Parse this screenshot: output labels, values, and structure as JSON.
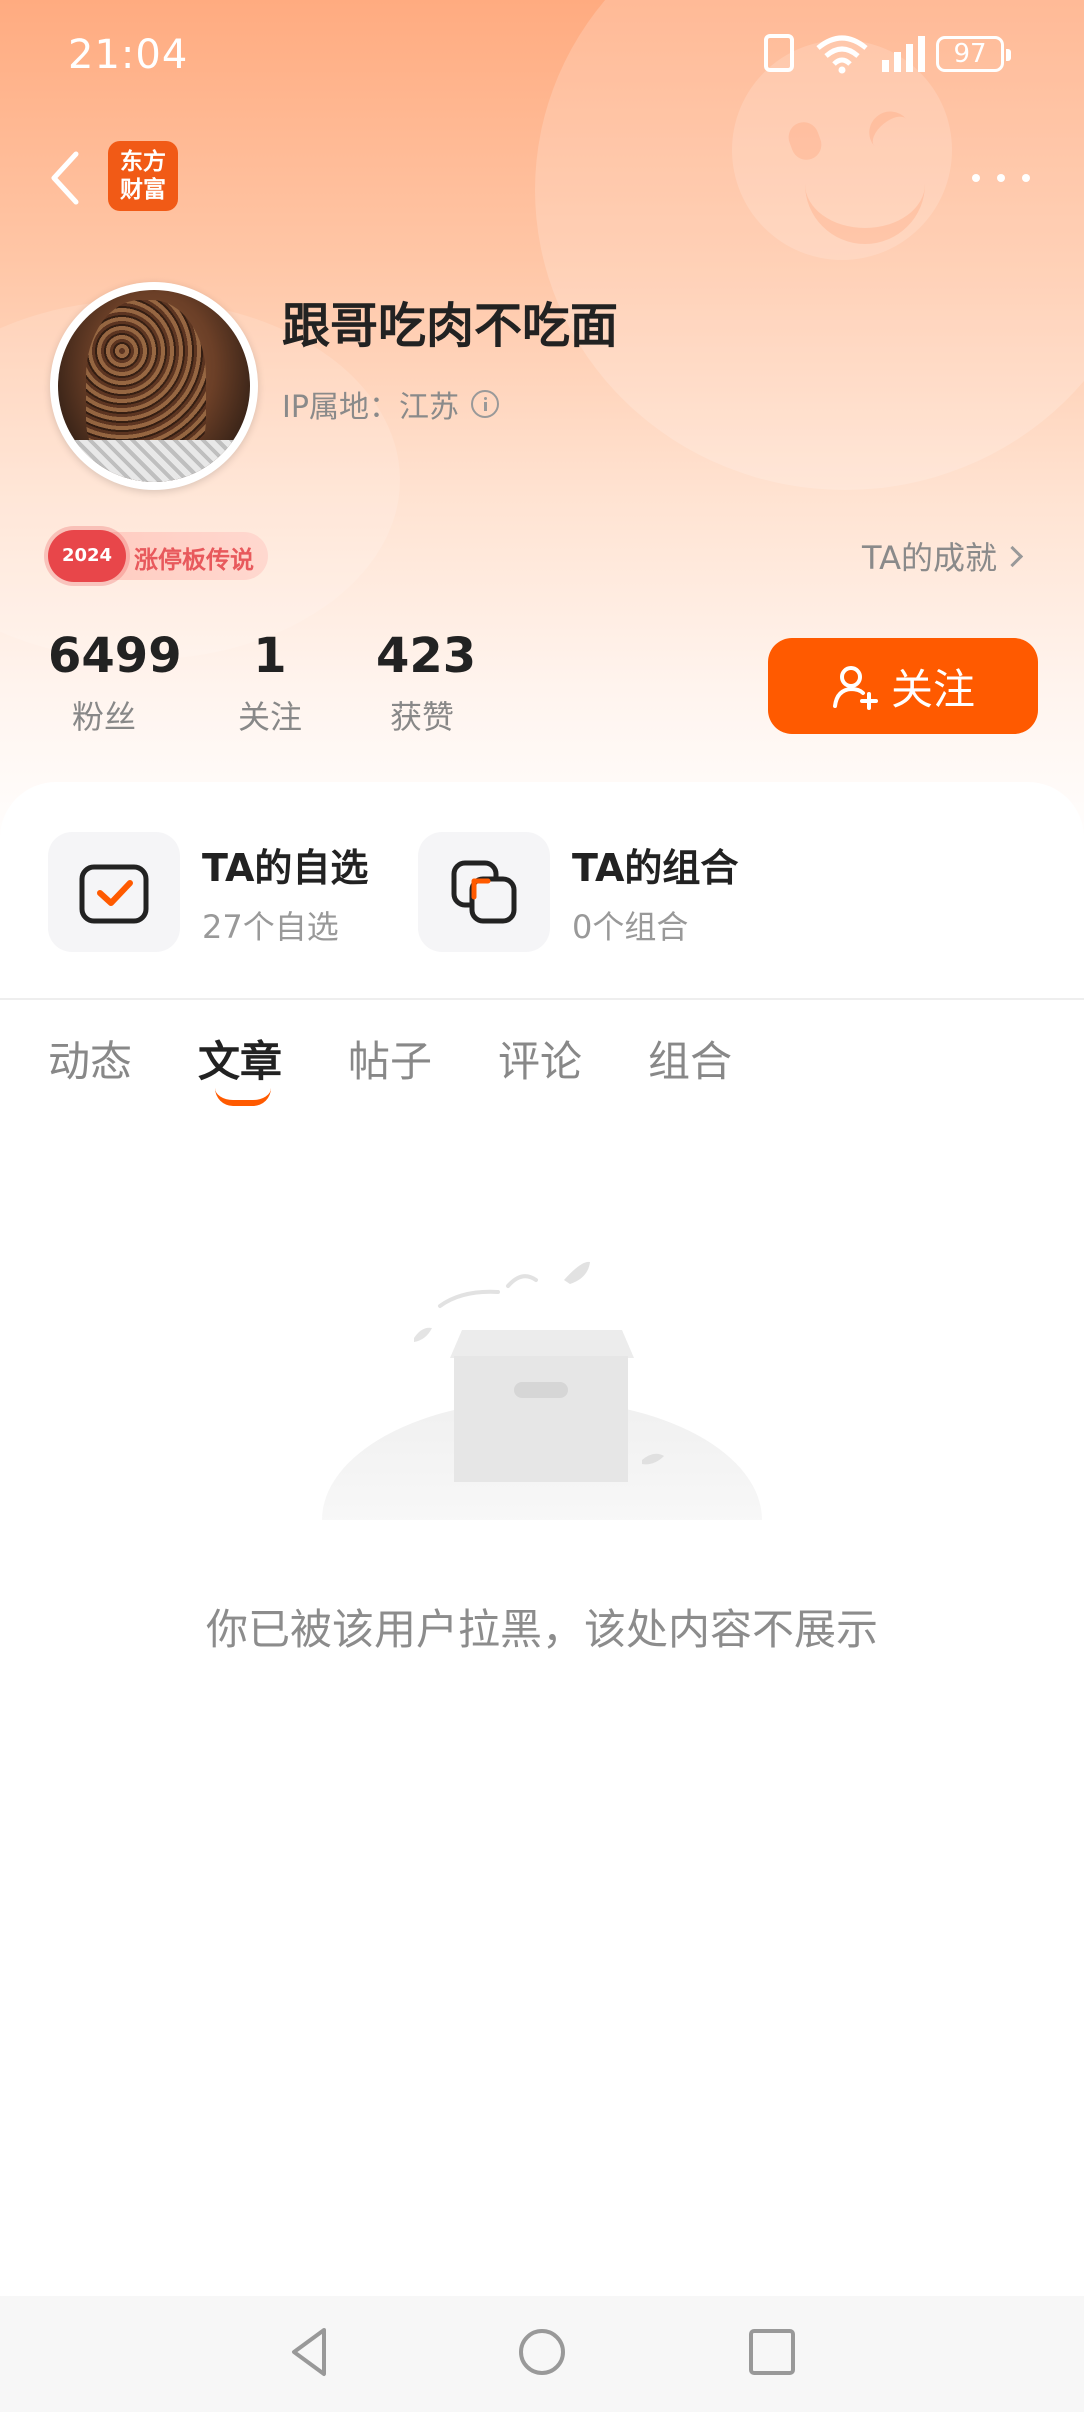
{
  "status_bar": {
    "time": "21:04",
    "battery": "97"
  },
  "header": {
    "logo_line1": "东方",
    "logo_line2": "财富"
  },
  "profile": {
    "username": "跟哥吃肉不吃面",
    "ip_location": "IP属地：江苏",
    "badge_year": "2024",
    "badge_text": "涨停板传说",
    "achievements_link": "TA的成就"
  },
  "stats": [
    {
      "value": "6499",
      "label": "粉丝"
    },
    {
      "value": "1",
      "label": "关注"
    },
    {
      "value": "423",
      "label": "获赞"
    }
  ],
  "follow_button": "关注",
  "portals": [
    {
      "title": "TA的自选",
      "subtitle": "27个自选"
    },
    {
      "title": "TA的组合",
      "subtitle": "0个组合"
    }
  ],
  "tabs": [
    {
      "label": "动态"
    },
    {
      "label": "文章",
      "active": true
    },
    {
      "label": "帖子"
    },
    {
      "label": "评论"
    },
    {
      "label": "组合"
    }
  ],
  "empty_state": {
    "message": "你已被该用户拉黑，该处内容不展示"
  },
  "colors": {
    "accent": "#ff5a00",
    "logo": "#f15a16",
    "badge": "#e8464a"
  }
}
